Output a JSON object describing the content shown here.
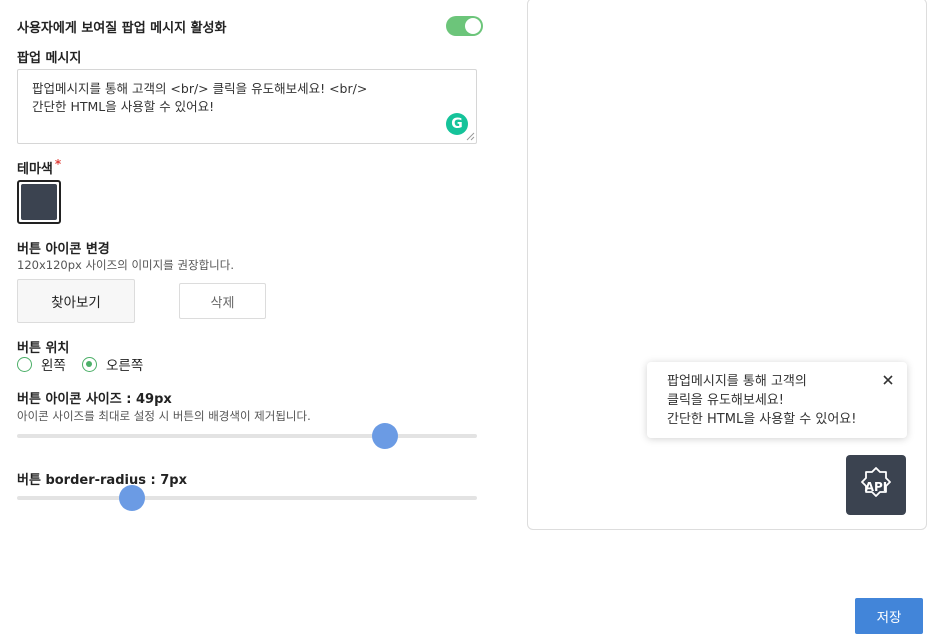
{
  "settings": {
    "popup_enable_label": "사용자에게 보여질 팝업 메시지 활성화",
    "popup_enabled": true,
    "popup_message_label": "팝업 메시지",
    "popup_message_value": "팝업메시지를 통해 고객의 <br/> 클릭을 유도해보세요! <br/>\n간단한 HTML을 사용할 수 있어요!",
    "theme_color_label": "테마색",
    "required_mark": "*",
    "theme_color": "#3b4350",
    "icon_change_label": "버튼 아이콘 변경",
    "icon_change_hint": "120x120px 사이즈의 이미지를 권장합니다.",
    "browse_button": "찾아보기",
    "delete_button": "삭제",
    "position_label": "버튼 위치",
    "position_left": "왼쪽",
    "position_right": "오른쪽",
    "position_selected": "오른쪽",
    "icon_size_label": "버튼 아이콘 사이즈 : 49px",
    "icon_size_hint": "아이콘 사이즈를 최대로 설정 시 버튼의 배경색이 제거됩니다.",
    "icon_size_slider_fraction": 0.8,
    "radius_label": "버튼 border-radius : 7px",
    "radius_slider_fraction": 0.25
  },
  "preview": {
    "popup_text": "팝업메시지를 통해 고객의\n클릭을 유도해보세요!\n간단한 HTML을 사용할 수 있어요!",
    "api_button_text": "API",
    "close_icon": "close-icon"
  },
  "footer": {
    "save_button": "저장"
  },
  "colors": {
    "toggle_on": "#6cc57a",
    "radio_accent": "#4caf68",
    "slider_thumb": "#6b9be4",
    "save_button": "#4285d9",
    "grammarly": "#15c39a"
  }
}
